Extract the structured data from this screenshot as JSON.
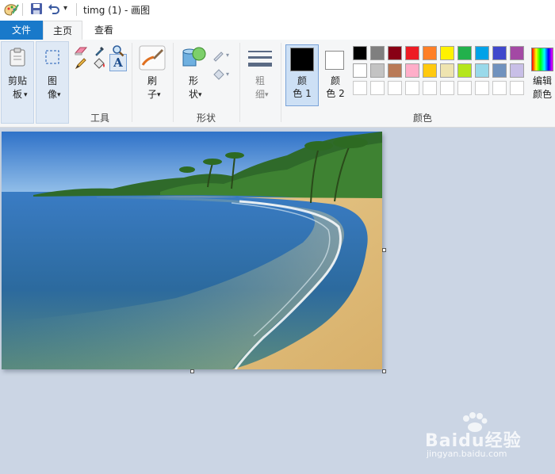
{
  "window": {
    "title": "timg (1) - 画图"
  },
  "menu": {
    "file": "文件",
    "home": "主页",
    "view": "查看"
  },
  "ribbon": {
    "paste": "剪贴板",
    "image": "图像",
    "tools_group": "工具",
    "brush": "刷子",
    "shapes": "形状",
    "shapes_group": "形状",
    "size": "粗细",
    "color1_line1": "颜",
    "color1_line2": "色 1",
    "color2_line1": "颜",
    "color2_line2": "色 2",
    "colors_group": "颜色",
    "edit_colors": "编辑颜色"
  },
  "colors": {
    "row1": [
      "#000000",
      "#7f7f7f",
      "#880015",
      "#ed1c24",
      "#ff7f27",
      "#fff200",
      "#22b14c",
      "#00a2e8",
      "#3f48cc",
      "#a349a4"
    ],
    "row2": [
      "#ffffff",
      "#c3c3c3",
      "#b97a57",
      "#ffaec9",
      "#ffc90e",
      "#efe4b0",
      "#b5e61d",
      "#99d9ea",
      "#7092be",
      "#c8bfe7"
    ],
    "color1": "#000000",
    "color2": "#ffffff",
    "accent": "#1979ca"
  },
  "canvas": {
    "image": "beach-photo"
  },
  "watermark": {
    "brand": "Baidu经验",
    "url": "jingyan.baidu.com"
  }
}
